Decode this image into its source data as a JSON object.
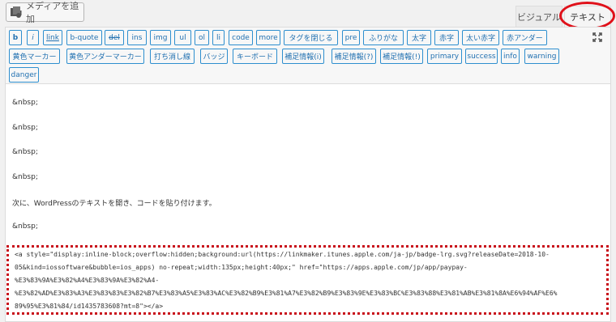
{
  "media_button": {
    "label": "メディアを追加",
    "icon": "media-icon"
  },
  "tabs": {
    "visual": "ビジュアル",
    "text": "テキスト"
  },
  "toolbar": {
    "buttons": [
      "b",
      "i",
      "link",
      "b-quote",
      "del",
      "ins",
      "img",
      "ul",
      "ol",
      "li",
      "code",
      "more",
      "タグを閉じる",
      "pre",
      "ふりがな",
      "太字",
      "赤字",
      "太い赤字",
      "赤アンダー",
      "黄色マーカー",
      "黄色アンダーマーカー",
      "打ち消し線",
      "バッジ",
      "キーボード",
      "補足情報(i)",
      "補足情報(?)",
      "補足情報(!)",
      "primary",
      "success",
      "info",
      "warning",
      "danger"
    ],
    "fullscreen_icon": "fullscreen-icon"
  },
  "content": {
    "lines": [
      "&nbsp;",
      "&nbsp;",
      "&nbsp;",
      "&nbsp;",
      "次に、WordPressのテキストを開き、コードを貼り付けます。",
      "&nbsp;"
    ],
    "code": [
      "<a style=\"display:inline-block;overflow:hidden;background:url(https://linkmaker.itunes.apple.com/ja-jp/badge-lrg.svg?releaseDate=2018-10-",
      "05&kind=iossoftware&bubble=ios_apps) no-repeat;width:135px;height:40px;\" href=\"https://apps.apple.com/jp/app/paypay-",
      "%E3%83%9A%E3%82%A4%E3%83%9A%E3%82%A4-",
      "%E3%82%AD%E3%83%A3%E3%83%83%E3%82%B7%E3%83%A5%E3%83%AC%E3%82%B9%E3%81%A7%E3%82%B9%E3%83%9E%E3%83%BC%E3%83%88%E3%81%AB%E3%81%8A%E6%94%AF%E6%",
      "89%95%E3%81%84/id1435783608?mt=8\"></a>"
    ]
  },
  "highlight_colors": {
    "circle": "#e0111a",
    "dotted_box": "#c8101a"
  }
}
